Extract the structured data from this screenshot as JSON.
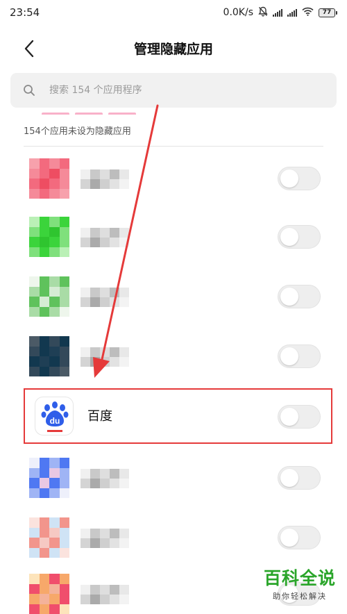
{
  "status_bar": {
    "time": "23:54",
    "network_speed": "0.0K/s",
    "battery": "77",
    "icons": [
      "mute-bell-icon",
      "signal-icon",
      "signal-icon",
      "wifi-icon",
      "battery-icon"
    ]
  },
  "header": {
    "back_icon": "back-chevron-icon",
    "title": "管理隐藏应用"
  },
  "search": {
    "icon": "search-icon",
    "placeholder": "搜索 154 个应用程序"
  },
  "list": {
    "section_header": "154个应用未设为隐藏应用",
    "highlighted_app": {
      "name": "百度",
      "icon": "baidu-paw-icon",
      "icon_text": "du",
      "hidden": false
    },
    "rows": [
      {
        "blurred": true,
        "hidden": false,
        "colors": [
          "#f7a1ac",
          "#f36a7e",
          "#f58a99",
          "#ee4d62"
        ]
      },
      {
        "blurred": true,
        "hidden": false,
        "colors": [
          "#baf0b6",
          "#3bd43b",
          "#7fe07c",
          "#2fc52f"
        ]
      },
      {
        "blurred": true,
        "hidden": false,
        "colors": [
          "#eef6ec",
          "#5fc25c",
          "#a9dca6",
          "#d6ecd4"
        ]
      },
      {
        "blurred": true,
        "hidden": false,
        "colors": [
          "#4b5a66",
          "#12384f",
          "#33495a",
          "#1f3f55"
        ]
      },
      {
        "blurred": false,
        "hidden": false
      },
      {
        "blurred": true,
        "hidden": false,
        "colors": [
          "#eef0fb",
          "#4f78f2",
          "#9fb4f5",
          "#e9c8e3"
        ]
      },
      {
        "blurred": true,
        "hidden": false,
        "colors": [
          "#fbe3de",
          "#f2958c",
          "#cfe3f5",
          "#f6c9c3"
        ]
      },
      {
        "blurred": true,
        "hidden": false,
        "colors": [
          "#fde4bb",
          "#f7a86a",
          "#f04e6c",
          "#f4b29a"
        ]
      }
    ]
  },
  "colors": {
    "highlight_border": "#e53a3a",
    "annotation_arrow": "#e53a3a",
    "baidu_blue": "#2f5ee9",
    "watermark_green": "#2aa52a"
  },
  "watermark": {
    "title": "百科全说",
    "subtitle": "助你轻松解决"
  }
}
